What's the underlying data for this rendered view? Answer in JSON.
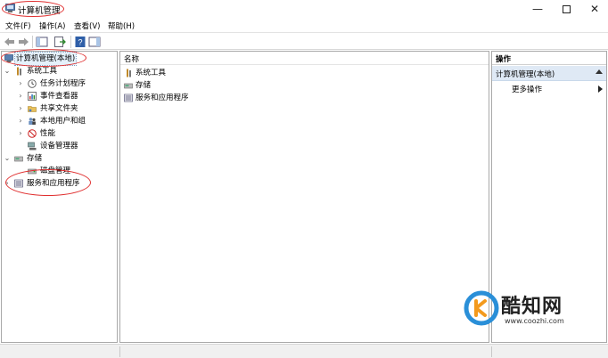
{
  "window": {
    "title": "计算机管理",
    "controls": {
      "minimize": "—",
      "close": "✕"
    }
  },
  "menu": {
    "items": [
      "文件(F)",
      "操作(A)",
      "查看(V)",
      "帮助(H)"
    ]
  },
  "tree": {
    "root": "计算机管理(本地)",
    "system_tools": "系统工具",
    "task_scheduler": "任务计划程序",
    "event_viewer": "事件查看器",
    "shared_folders": "共享文件夹",
    "local_users": "本地用户和组",
    "performance": "性能",
    "device_manager": "设备管理器",
    "storage": "存储",
    "disk_management": "磁盘管理",
    "services_apps": "服务和应用程序"
  },
  "center": {
    "column_name": "名称",
    "rows": [
      "系统工具",
      "存储",
      "服务和应用程序"
    ]
  },
  "actions": {
    "header": "操作",
    "section": "计算机管理(本地)",
    "more": "更多操作"
  },
  "watermark": {
    "name": "酷知网",
    "url": "www.coozhi.com"
  },
  "colors": {
    "annotation": "#e03030",
    "selection": "#e5f1fb",
    "actions_section": "#dfe9f5",
    "watermark_blue": "#2a8fd8",
    "watermark_orange": "#f39a1e"
  }
}
